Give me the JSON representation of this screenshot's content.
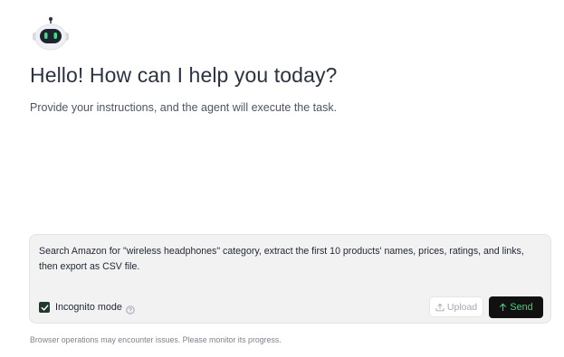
{
  "header": {
    "logo_icon": "robot-icon",
    "greeting": "Hello! How can I help you today?",
    "subtitle": "Provide your instructions, and the agent will execute the task."
  },
  "composer": {
    "prompt_text": "Search Amazon for \"wireless headphones\" category, extract the first 10 products' names, prices, ratings, and links, then export as CSV file.",
    "incognito": {
      "label": "Incognito mode",
      "checked": true,
      "help_icon": "question-circle-icon"
    },
    "upload_label": "Upload",
    "upload_icon": "upload-icon",
    "send_label": "Send",
    "send_icon": "arrow-up-icon"
  },
  "footer": {
    "notice": "Browser operations may encounter issues. Please monitor its progress."
  },
  "colors": {
    "send_button_bg": "#111111",
    "send_button_text": "#3fd07a",
    "checkbox_bg": "#1f3b2e",
    "composer_bg": "#f2f2f2"
  }
}
